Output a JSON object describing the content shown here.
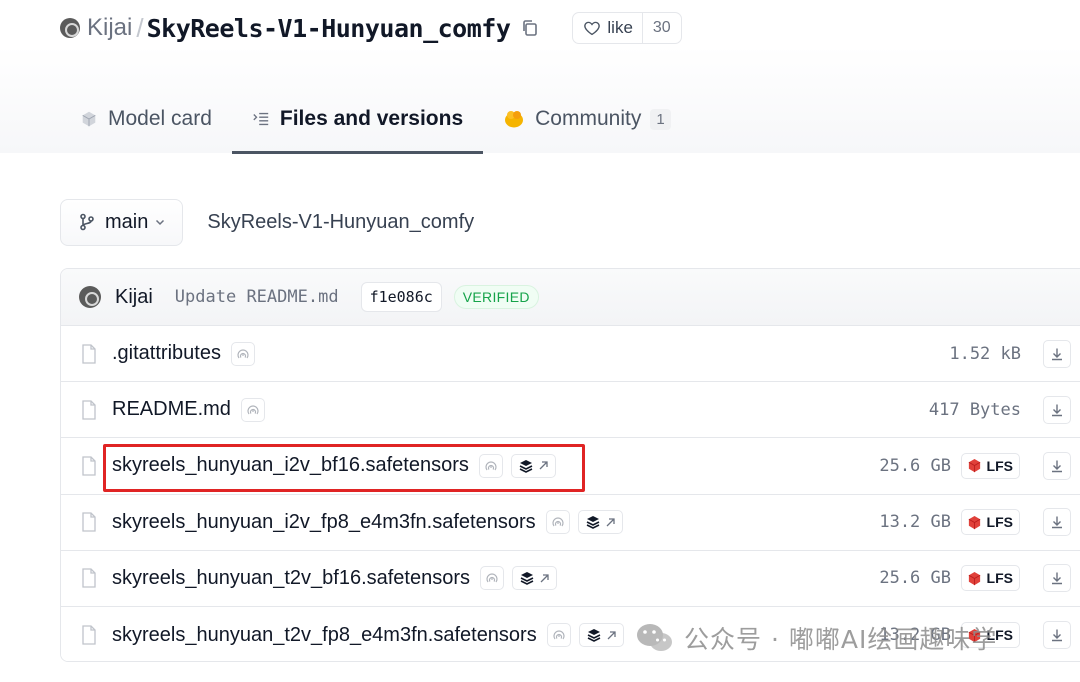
{
  "repo": {
    "owner": "Kijai",
    "separator": "/",
    "name": "SkyReels-V1-Hunyuan_comfy",
    "like_label": "like",
    "like_count": "30"
  },
  "tabs": [
    {
      "label": "Model card",
      "icon": "model-card-icon"
    },
    {
      "label": "Files and versions",
      "icon": "files-list-icon",
      "active": true
    },
    {
      "label": "Community",
      "icon": "community-icon",
      "badge": "1"
    }
  ],
  "branch": {
    "label": "main",
    "path": "SkyReels-V1-Hunyuan_comfy"
  },
  "commit": {
    "author": "Kijai",
    "message": "Update README.md",
    "hash": "f1e086c",
    "verified": "VERIFIED"
  },
  "files": [
    {
      "name": ".gitattributes",
      "size": "1.52 kB",
      "lfs": false,
      "xet": false
    },
    {
      "name": "README.md",
      "size": "417 Bytes",
      "lfs": false,
      "xet": false
    },
    {
      "name": "skyreels_hunyuan_i2v_bf16.safetensors",
      "size": "25.6 GB",
      "lfs": true,
      "xet": true,
      "highlighted": true
    },
    {
      "name": "skyreels_hunyuan_i2v_fp8_e4m3fn.safetensors",
      "size": "13.2 GB",
      "lfs": true,
      "xet": true
    },
    {
      "name": "skyreels_hunyuan_t2v_bf16.safetensors",
      "size": "25.6 GB",
      "lfs": true,
      "xet": true
    },
    {
      "name": "skyreels_hunyuan_t2v_fp8_e4m3fn.safetensors",
      "size": "13.2 GB",
      "lfs": true,
      "xet": true
    }
  ],
  "lfs_label": "LFS",
  "watermark": {
    "text": "公众号 · 嘟嘟AI绘画趣味学"
  },
  "colors": {
    "highlight": "#e02424",
    "verified": "#16a34a",
    "lfs": "#e0413a",
    "community": "#f5b400"
  }
}
